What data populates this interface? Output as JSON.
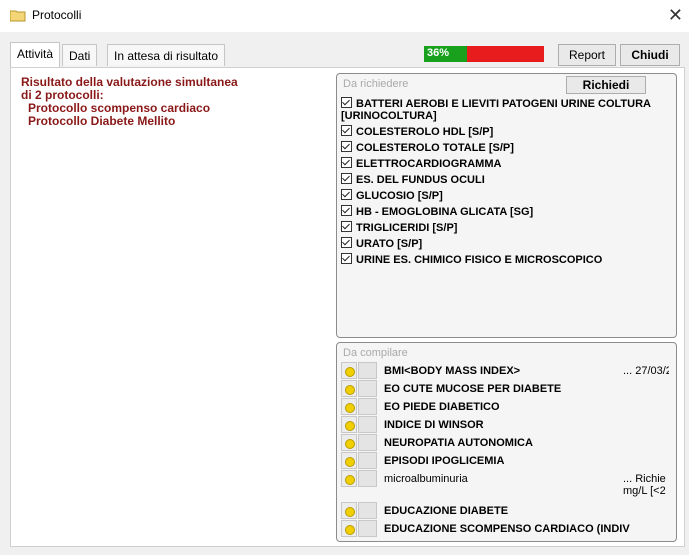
{
  "window": {
    "title": "Protocolli",
    "close_glyph": "✕"
  },
  "tabs": [
    {
      "label": "Attività",
      "active": true
    },
    {
      "label": "Dati",
      "active": false
    },
    {
      "label": "In attesa di risultato",
      "active": false
    }
  ],
  "progress": {
    "value_percent": 36,
    "label": "36%",
    "color_done": "#19a11e",
    "color_remaining": "#e81c1c"
  },
  "buttons": {
    "report": "Report",
    "close": "Chiudi"
  },
  "result": {
    "line1": "Risultato della valutazione simultanea",
    "line2": "di 2 protocolli:",
    "protocols": [
      "Protocollo scompenso cardiaco",
      "Protocollo Diabete Mellito"
    ]
  },
  "da_richiedere": {
    "label": "Da richiedere",
    "button": "Richiedi",
    "items": [
      "BATTERI AEROBI E LIEVITI PATOGENI URINE COLTURA [URINOCOLTURA]",
      "COLESTEROLO HDL [S/P]",
      "COLESTEROLO TOTALE [S/P]",
      "ELETTROCARDIOGRAMMA",
      "ES. DEL FUNDUS OCULI",
      "GLUCOSIO [S/P]",
      "HB - EMOGLOBINA GLICATA [SG]",
      "TRIGLICERIDI [S/P]",
      "URATO [S/P]",
      "URINE ES. CHIMICO FISICO E MICROSCOPICO"
    ]
  },
  "da_compilare": {
    "label": "Da compilare",
    "items": [
      {
        "label": "BMI<BODY MASS INDEX>",
        "extra": "... 27/03/2"
      },
      {
        "label": "EO CUTE MUCOSE PER DIABETE",
        "extra": ""
      },
      {
        "label": "EO PIEDE DIABETICO",
        "extra": ""
      },
      {
        "label": "INDICE DI WINSOR",
        "extra": ""
      },
      {
        "label": "NEUROPATIA AUTONOMICA",
        "extra": ""
      },
      {
        "label": "EPISODI IPOGLICEMIA",
        "extra": ""
      },
      {
        "label": "microalbuminuria",
        "extra": "... Richie",
        "extra2": "mg/L [<2"
      },
      {
        "label": "EDUCAZIONE DIABETE",
        "extra": ""
      },
      {
        "label": "EDUCAZIONE SCOMPENSO CARDIACO (INDIV",
        "extra": ""
      }
    ]
  }
}
